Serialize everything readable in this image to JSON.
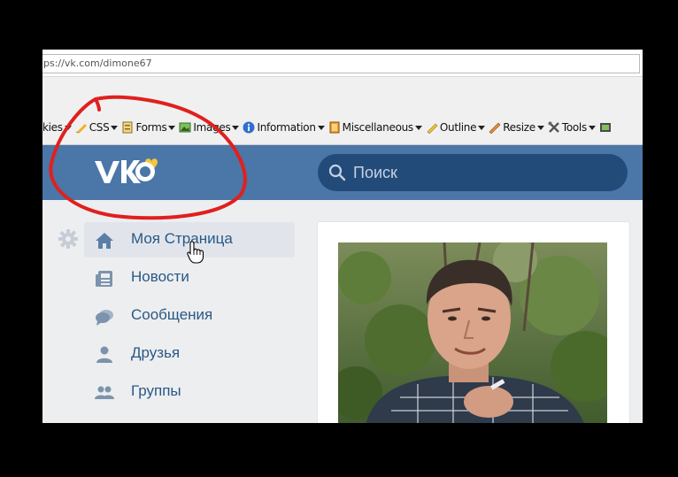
{
  "browser": {
    "url": "ps://vk.com/dimone67"
  },
  "webdev_toolbar": {
    "items": [
      {
        "label": "kies",
        "icon": "cookie-icon"
      },
      {
        "label": "CSS",
        "icon": "css-pencil-icon"
      },
      {
        "label": "Forms",
        "icon": "forms-icon"
      },
      {
        "label": "Images",
        "icon": "images-icon"
      },
      {
        "label": "Information",
        "icon": "info-icon"
      },
      {
        "label": "Miscellaneous",
        "icon": "miscellaneous-icon"
      },
      {
        "label": "Outline",
        "icon": "outline-pencil-icon"
      },
      {
        "label": "Resize",
        "icon": "resize-icon"
      },
      {
        "label": "Tools",
        "icon": "tools-icon"
      }
    ]
  },
  "vk": {
    "search_placeholder": "Поиск",
    "colors": {
      "header": "#4a76a8",
      "search_bg": "#224b7a",
      "link": "#2a5885",
      "page_bg": "#edeef0",
      "annotation": "#e0201e"
    },
    "nav": [
      {
        "label": "Моя Страница",
        "icon": "home-icon",
        "active": true
      },
      {
        "label": "Новости",
        "icon": "news-icon",
        "active": false
      },
      {
        "label": "Сообщения",
        "icon": "messages-icon",
        "active": false
      },
      {
        "label": "Друзья",
        "icon": "friends-icon",
        "active": false
      },
      {
        "label": "Группы",
        "icon": "groups-icon",
        "active": false
      }
    ]
  }
}
